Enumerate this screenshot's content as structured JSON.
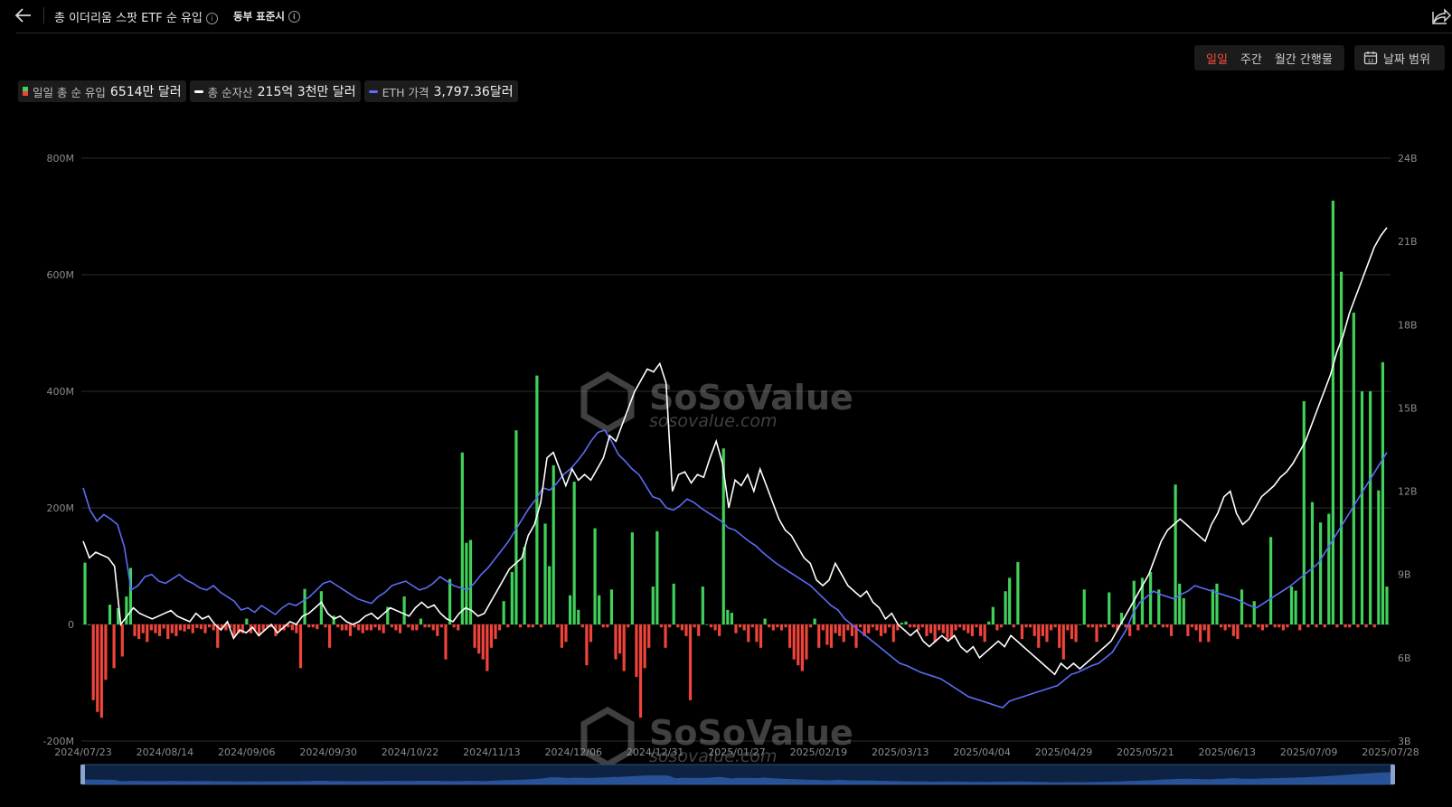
{
  "header": {
    "title": "총 이더리움 스팟 ETF 순 유입",
    "timezone": "동부 표준시"
  },
  "period_buttons": [
    "일일",
    "주간",
    "월간 간행물"
  ],
  "active_period": "일일",
  "date_range_label": "날짜 범위",
  "legend": [
    {
      "label": "일일 총 순 유입",
      "value": "6514만 달러"
    },
    {
      "label": "총 순자산",
      "value": "215억 3천만 달러"
    },
    {
      "label": "ETH 가격",
      "value": "3,797.36달러"
    }
  ],
  "watermark": {
    "brand": "SoSoValue",
    "url": "sosovalue.com"
  },
  "colors": {
    "inflow": "#3fd15a",
    "outflow": "#f0433a",
    "net_assets": "#ffffff",
    "eth_price": "#5b6cf5",
    "grid": "#2b2b2b"
  },
  "chart_data": {
    "type": "bar",
    "title": "총 이더리움 스팟 ETF 순 유입",
    "x_labels": [
      "2024/07/23",
      "2024/08/14",
      "2024/09/06",
      "2024/09/30",
      "2024/10/22",
      "2024/11/13",
      "2024/12/06",
      "2024/12/31",
      "2025/01/27",
      "2025/02/19",
      "2025/03/13",
      "2025/04/04",
      "2025/04/29",
      "2025/05/21",
      "2025/06/13",
      "2025/07/09",
      "2025/07/28"
    ],
    "y_left": {
      "ticks": [
        "800M",
        "600M",
        "400M",
        "200M",
        "0",
        "-200M"
      ],
      "range": [
        -200,
        800
      ],
      "unit": "M USD"
    },
    "y_right": {
      "ticks": [
        "24B",
        "21B",
        "18B",
        "15B",
        "12B",
        "9B",
        "6B",
        "3B"
      ],
      "range": [
        3,
        24
      ],
      "unit": "B USD"
    },
    "grid": true,
    "series": [
      {
        "name": "일일 총 순 유입",
        "kind": "bar",
        "values": [
          106,
          0,
          -130,
          -150,
          -160,
          -95,
          34,
          -75,
          28,
          -55,
          48,
          97,
          -20,
          -25,
          -15,
          -30,
          -10,
          -15,
          -20,
          -7,
          -25,
          -15,
          -20,
          -10,
          -12,
          -8,
          -15,
          -6,
          -8,
          -15,
          -5,
          -10,
          -40,
          -8,
          -10,
          -6,
          -20,
          -15,
          -15,
          10,
          -15,
          -10,
          -20,
          -10,
          -5,
          -5,
          -20,
          -10,
          -10,
          -5,
          -10,
          -15,
          -75,
          61,
          -5,
          -5,
          -8,
          57,
          -5,
          -40,
          15,
          -5,
          -10,
          -10,
          -20,
          -5,
          -10,
          -15,
          -10,
          -10,
          -5,
          -10,
          -15,
          30,
          -5,
          -10,
          -15,
          48,
          -5,
          -10,
          -10,
          10,
          -5,
          -5,
          -10,
          -20,
          -5,
          -60,
          78,
          -5,
          -10,
          295,
          140,
          145,
          -40,
          -50,
          -60,
          -80,
          -40,
          -25,
          -10,
          40,
          -5,
          90,
          333,
          -5,
          133,
          -5,
          -5,
          427,
          -5,
          173,
          100,
          273,
          -5,
          -40,
          -30,
          50,
          245,
          25,
          -5,
          -70,
          -30,
          165,
          50,
          -5,
          -5,
          60,
          -60,
          -50,
          -80,
          -5,
          158,
          -90,
          -160,
          -75,
          -40,
          65,
          160,
          -5,
          -40,
          -5,
          70,
          -5,
          -10,
          -20,
          -130,
          -5,
          -20,
          65,
          0,
          -5,
          -10,
          -20,
          302,
          25,
          20,
          -15,
          -5,
          -10,
          -30,
          -5,
          -30,
          -40,
          10,
          -5,
          -10,
          -5,
          -10,
          -5,
          -40,
          -60,
          -70,
          -80,
          -60,
          -5,
          10,
          -40,
          -10,
          -35,
          -40,
          -15,
          -20,
          -30,
          -10,
          -20,
          -40,
          -5,
          -20,
          -15,
          -5,
          -10,
          -20,
          -15,
          -5,
          -30,
          -10,
          3,
          5,
          -5,
          -5,
          -10,
          -5,
          -20,
          -15,
          -30,
          -10,
          -15,
          -25,
          -25,
          -10,
          -5,
          -10,
          -15,
          -20,
          -5,
          -20,
          -30,
          5,
          30,
          -10,
          -5,
          57,
          80,
          -5,
          107,
          -25,
          -5,
          -5,
          -20,
          -40,
          -20,
          -30,
          -10,
          -5,
          -40,
          -60,
          -10,
          -25,
          -30,
          0,
          60,
          -5,
          -5,
          -30,
          -5,
          -5,
          55,
          -5,
          -10,
          20,
          -5,
          -20,
          75,
          -10,
          80,
          -5,
          90,
          -5,
          60,
          -5,
          -5,
          -20,
          240,
          70,
          45,
          -20,
          -5,
          -10,
          -30,
          -10,
          -30,
          60,
          70,
          -5,
          -10,
          -5,
          -20,
          -25,
          60,
          -5,
          -5,
          40,
          -5,
          -10,
          -5,
          150,
          -5,
          -5,
          -10,
          -5,
          65,
          58,
          -10,
          383,
          -5,
          210,
          -5,
          175,
          -5,
          190,
          727,
          -5,
          605,
          -5,
          -5,
          535,
          -5,
          400,
          -5,
          400,
          -5,
          230,
          450,
          65
        ]
      },
      {
        "name": "총 순자산",
        "kind": "line",
        "axis": "right",
        "values": [
          10.2,
          9.6,
          9.8,
          9.7,
          9.6,
          9.3,
          7.2,
          7.5,
          7.8,
          7.6,
          7.5,
          7.4,
          7.5,
          7.6,
          7.7,
          7.5,
          7.4,
          7.3,
          7.6,
          7.4,
          7.5,
          7.2,
          7.0,
          7.3,
          6.7,
          7.0,
          6.9,
          7.1,
          6.8,
          7.0,
          7.2,
          6.9,
          7.1,
          7.3,
          7.2,
          7.5,
          7.6,
          7.8,
          8.0,
          7.6,
          7.4,
          7.5,
          7.3,
          7.2,
          7.3,
          7.5,
          7.6,
          7.4,
          7.6,
          7.8,
          7.7,
          7.6,
          7.5,
          7.8,
          8.0,
          7.8,
          7.9,
          7.6,
          7.4,
          7.3,
          7.6,
          7.8,
          7.7,
          7.5,
          7.6,
          8.0,
          8.4,
          8.8,
          9.2,
          9.4,
          9.6,
          10.4,
          10.8,
          11.6,
          13.2,
          13.4,
          12.8,
          12.2,
          12.8,
          12.4,
          12.6,
          12.4,
          12.8,
          13.2,
          14.0,
          13.8,
          14.4,
          15.0,
          15.6,
          16.0,
          16.4,
          16.3,
          16.6,
          15.9,
          12.0,
          12.6,
          12.7,
          12.3,
          12.6,
          12.5,
          13.2,
          13.8,
          13.0,
          11.4,
          12.4,
          12.2,
          12.6,
          12.0,
          12.8,
          12.2,
          11.6,
          11.0,
          10.6,
          10.4,
          10.0,
          9.6,
          9.4,
          8.8,
          8.6,
          8.8,
          9.4,
          9.0,
          8.6,
          8.4,
          8.2,
          8.4,
          8.0,
          7.8,
          7.4,
          7.6,
          7.2,
          7.0,
          6.8,
          7.0,
          6.6,
          6.4,
          6.6,
          6.8,
          6.6,
          6.8,
          6.4,
          6.2,
          6.4,
          6.0,
          6.2,
          6.4,
          6.6,
          6.4,
          6.8,
          6.6,
          6.4,
          6.2,
          6.0,
          5.8,
          5.6,
          5.4,
          5.8,
          5.6,
          5.8,
          5.6,
          5.8,
          6.0,
          6.2,
          6.4,
          6.6,
          7.0,
          7.4,
          7.8,
          8.2,
          8.6,
          9.0,
          9.6,
          10.2,
          10.6,
          10.8,
          11.0,
          10.8,
          10.6,
          10.4,
          10.2,
          10.8,
          11.2,
          11.8,
          12.0,
          11.2,
          10.8,
          11.0,
          11.4,
          11.8,
          12.0,
          12.2,
          12.5,
          12.7,
          13.0,
          13.4,
          13.8,
          14.4,
          15.0,
          15.6,
          16.2,
          17.0,
          17.6,
          18.4,
          19.0,
          19.6,
          20.2,
          20.8,
          21.2,
          21.5
        ]
      },
      {
        "name": "ETH 가격",
        "kind": "line",
        "axis": "right",
        "values": [
          3480,
          3280,
          3180,
          3240,
          3200,
          3150,
          2950,
          2560,
          2600,
          2680,
          2700,
          2640,
          2620,
          2660,
          2700,
          2650,
          2620,
          2580,
          2560,
          2600,
          2540,
          2500,
          2460,
          2380,
          2400,
          2360,
          2420,
          2380,
          2340,
          2400,
          2440,
          2420,
          2460,
          2500,
          2560,
          2620,
          2640,
          2600,
          2560,
          2520,
          2480,
          2460,
          2440,
          2500,
          2540,
          2600,
          2620,
          2640,
          2600,
          2560,
          2580,
          2620,
          2680,
          2640,
          2600,
          2580,
          2560,
          2620,
          2700,
          2760,
          2840,
          2920,
          3000,
          3100,
          3200,
          3300,
          3380,
          3480,
          3460,
          3520,
          3600,
          3650,
          3720,
          3800,
          3900,
          3980,
          4000,
          3900,
          3780,
          3720,
          3650,
          3600,
          3500,
          3400,
          3380,
          3300,
          3280,
          3320,
          3380,
          3350,
          3300,
          3260,
          3220,
          3180,
          3120,
          3100,
          3050,
          3000,
          2960,
          2900,
          2850,
          2800,
          2760,
          2720,
          2680,
          2640,
          2600,
          2540,
          2480,
          2420,
          2380,
          2300,
          2250,
          2200,
          2150,
          2100,
          2050,
          2000,
          1950,
          1900,
          1880,
          1850,
          1820,
          1800,
          1780,
          1760,
          1720,
          1680,
          1640,
          1600,
          1580,
          1560,
          1540,
          1520,
          1500,
          1560,
          1580,
          1600,
          1620,
          1640,
          1660,
          1680,
          1700,
          1750,
          1800,
          1820,
          1850,
          1880,
          1900,
          1950,
          2000,
          2100,
          2200,
          2350,
          2450,
          2500,
          2550,
          2520,
          2500,
          2480,
          2520,
          2550,
          2600,
          2580,
          2560,
          2540,
          2520,
          2500,
          2480,
          2450,
          2420,
          2400,
          2440,
          2480,
          2520,
          2560,
          2600,
          2650,
          2700,
          2750,
          2800,
          2900,
          3000,
          3100,
          3200,
          3300,
          3400,
          3500,
          3600,
          3700,
          3800
        ]
      }
    ]
  }
}
